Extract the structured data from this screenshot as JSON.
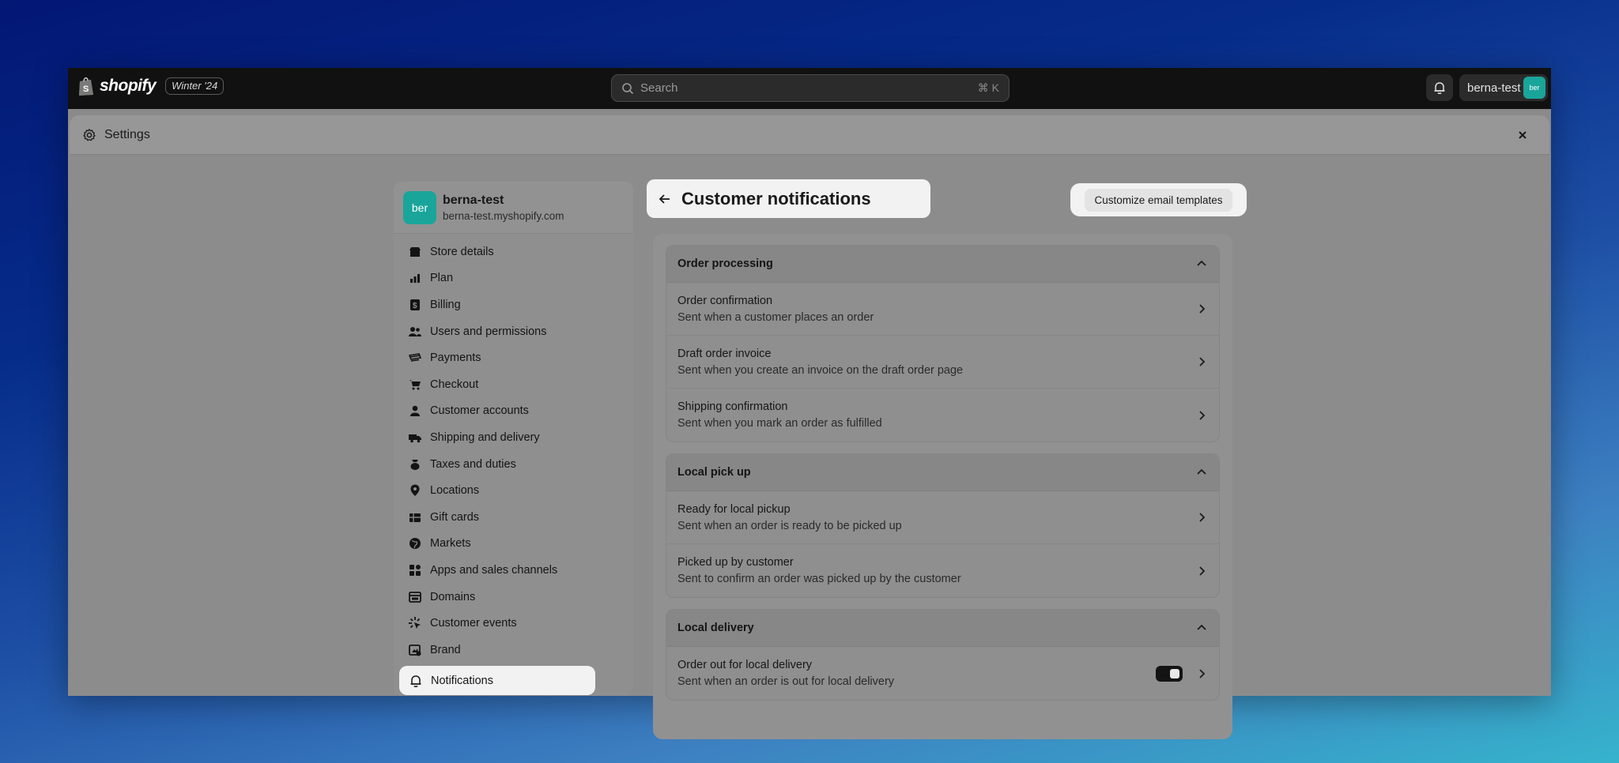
{
  "topbar": {
    "brand": "shopify",
    "edition": "Winter '24",
    "search_placeholder": "Search",
    "search_shortcut": "⌘ K",
    "store_name": "berna-test",
    "avatar_initials": "ber"
  },
  "settings": {
    "title": "Settings"
  },
  "store": {
    "initials": "ber",
    "name": "berna-test",
    "url": "berna-test.myshopify.com"
  },
  "sidebar": {
    "items": [
      {
        "label": "Store details",
        "icon": "store-icon"
      },
      {
        "label": "Plan",
        "icon": "plan-icon"
      },
      {
        "label": "Billing",
        "icon": "billing-icon"
      },
      {
        "label": "Users and permissions",
        "icon": "users-icon"
      },
      {
        "label": "Payments",
        "icon": "payments-icon"
      },
      {
        "label": "Checkout",
        "icon": "cart-icon"
      },
      {
        "label": "Customer accounts",
        "icon": "person-icon"
      },
      {
        "label": "Shipping and delivery",
        "icon": "truck-icon"
      },
      {
        "label": "Taxes and duties",
        "icon": "taxes-icon"
      },
      {
        "label": "Locations",
        "icon": "location-icon"
      },
      {
        "label": "Gift cards",
        "icon": "gift-card-icon"
      },
      {
        "label": "Markets",
        "icon": "globe-icon"
      },
      {
        "label": "Apps and sales channels",
        "icon": "apps-icon"
      },
      {
        "label": "Domains",
        "icon": "domains-icon"
      },
      {
        "label": "Customer events",
        "icon": "events-icon"
      },
      {
        "label": "Brand",
        "icon": "brand-icon"
      }
    ],
    "active": {
      "label": "Notifications",
      "icon": "bell-icon"
    }
  },
  "page": {
    "title": "Customer notifications",
    "action_label": "Customize email templates"
  },
  "sections": [
    {
      "title": "Order processing",
      "rows": [
        {
          "title": "Order confirmation",
          "desc": "Sent when a customer places an order"
        },
        {
          "title": "Draft order invoice",
          "desc": "Sent when you create an invoice on the draft order page"
        },
        {
          "title": "Shipping confirmation",
          "desc": "Sent when you mark an order as fulfilled"
        }
      ]
    },
    {
      "title": "Local pick up",
      "rows": [
        {
          "title": "Ready for local pickup",
          "desc": "Sent when an order is ready to be picked up"
        },
        {
          "title": "Picked up by customer",
          "desc": "Sent to confirm an order was picked up by the customer"
        }
      ]
    },
    {
      "title": "Local delivery",
      "rows": [
        {
          "title": "Order out for local delivery",
          "desc": "Sent when an order is out for local delivery",
          "toggle": true
        }
      ]
    }
  ]
}
